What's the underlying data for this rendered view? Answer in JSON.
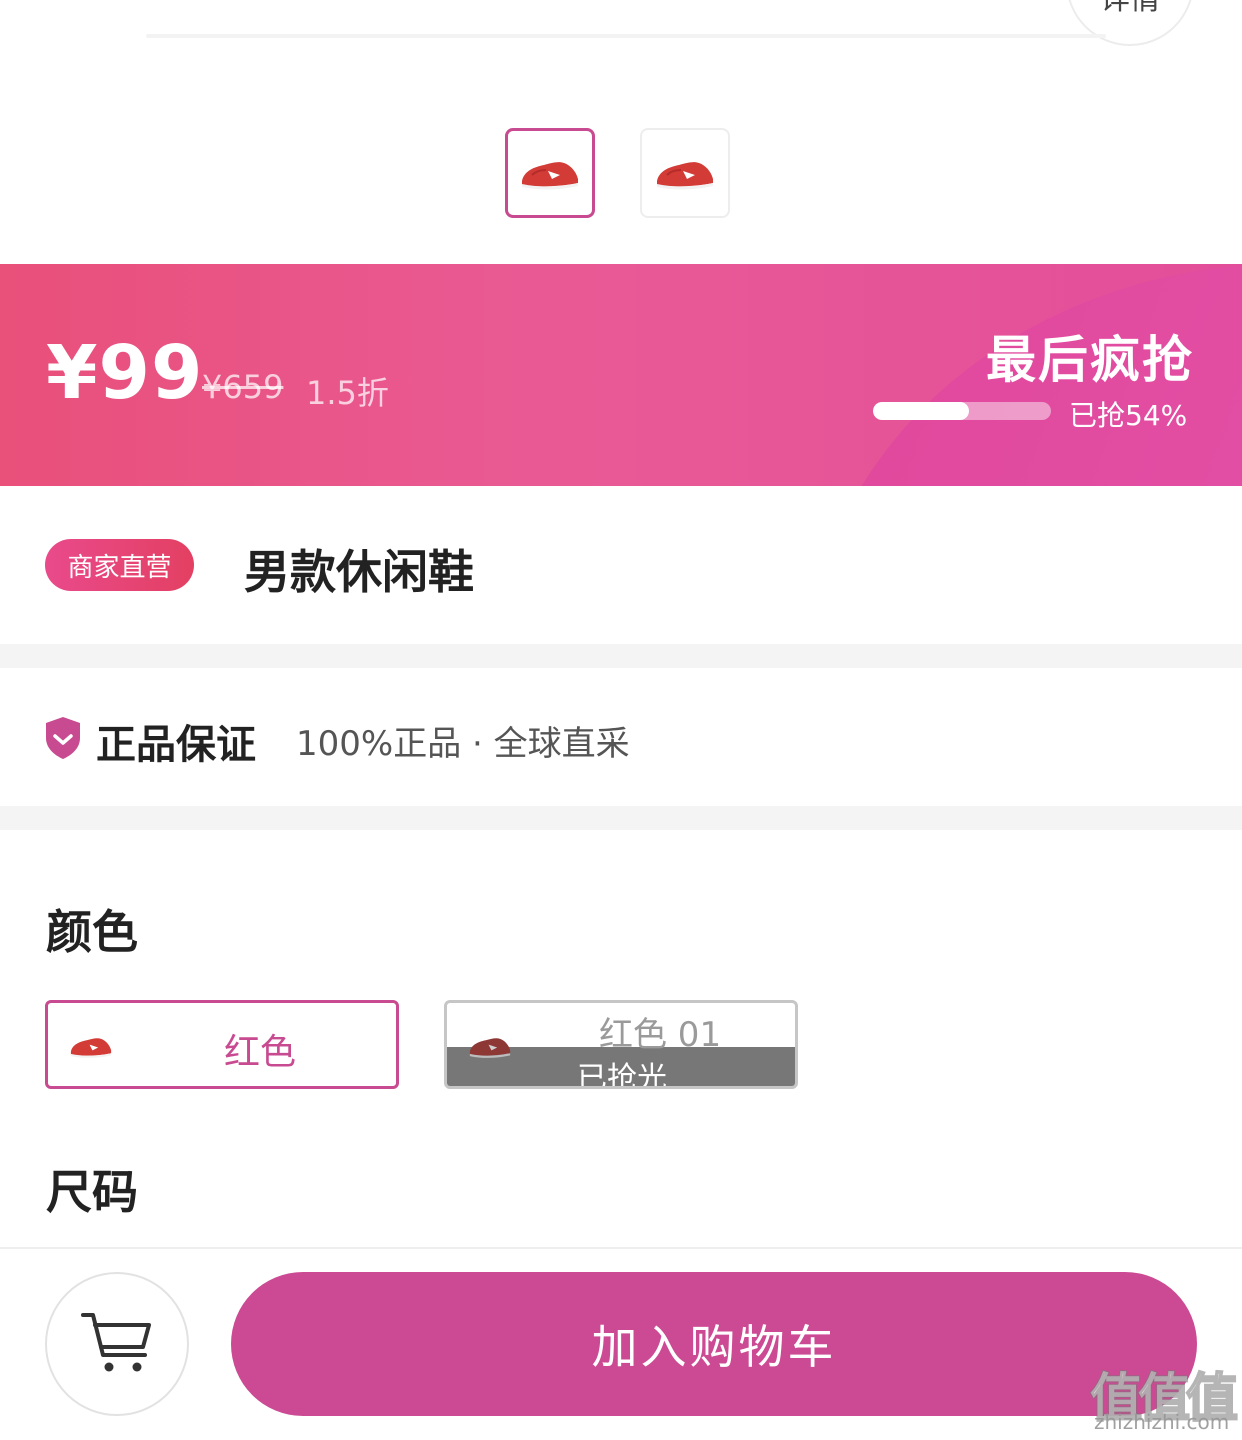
{
  "header": {
    "details_label": "详情"
  },
  "gallery": {
    "thumbnails": [
      {
        "name": "red-shoe-view-1",
        "selected": true
      },
      {
        "name": "red-shoe-view-2",
        "selected": false
      }
    ]
  },
  "promo": {
    "current_price": "¥99",
    "original_price": "¥659",
    "discount": "1.5折",
    "headline": "最后疯抢",
    "progress_text": "已抢54%",
    "progress_fraction": 0.54
  },
  "product": {
    "badge": "商家直营",
    "title": "男款休闲鞋"
  },
  "guarantee": {
    "icon": "shield-check-icon",
    "title": "正品保证",
    "description": "100%正品 · 全球直采"
  },
  "colors": {
    "label": "颜色",
    "options": [
      {
        "label": "红色",
        "selected": true,
        "sold_out": false
      },
      {
        "label": "红色 01",
        "selected": false,
        "sold_out": true,
        "sold_out_label": "已抢光"
      }
    ]
  },
  "sizes": {
    "label": "尺码"
  },
  "actions": {
    "cart_icon": "shopping-cart-icon",
    "add_to_cart_label": "加入购物车"
  },
  "watermark": {
    "logo": "值值值",
    "url": "zhizhizhi.com"
  },
  "theme": {
    "accent": "#c84a90",
    "banner_start": "#e9507a",
    "banner_end": "#e455ad",
    "badge_start": "#e94a8b",
    "badge_end": "#e34062"
  }
}
